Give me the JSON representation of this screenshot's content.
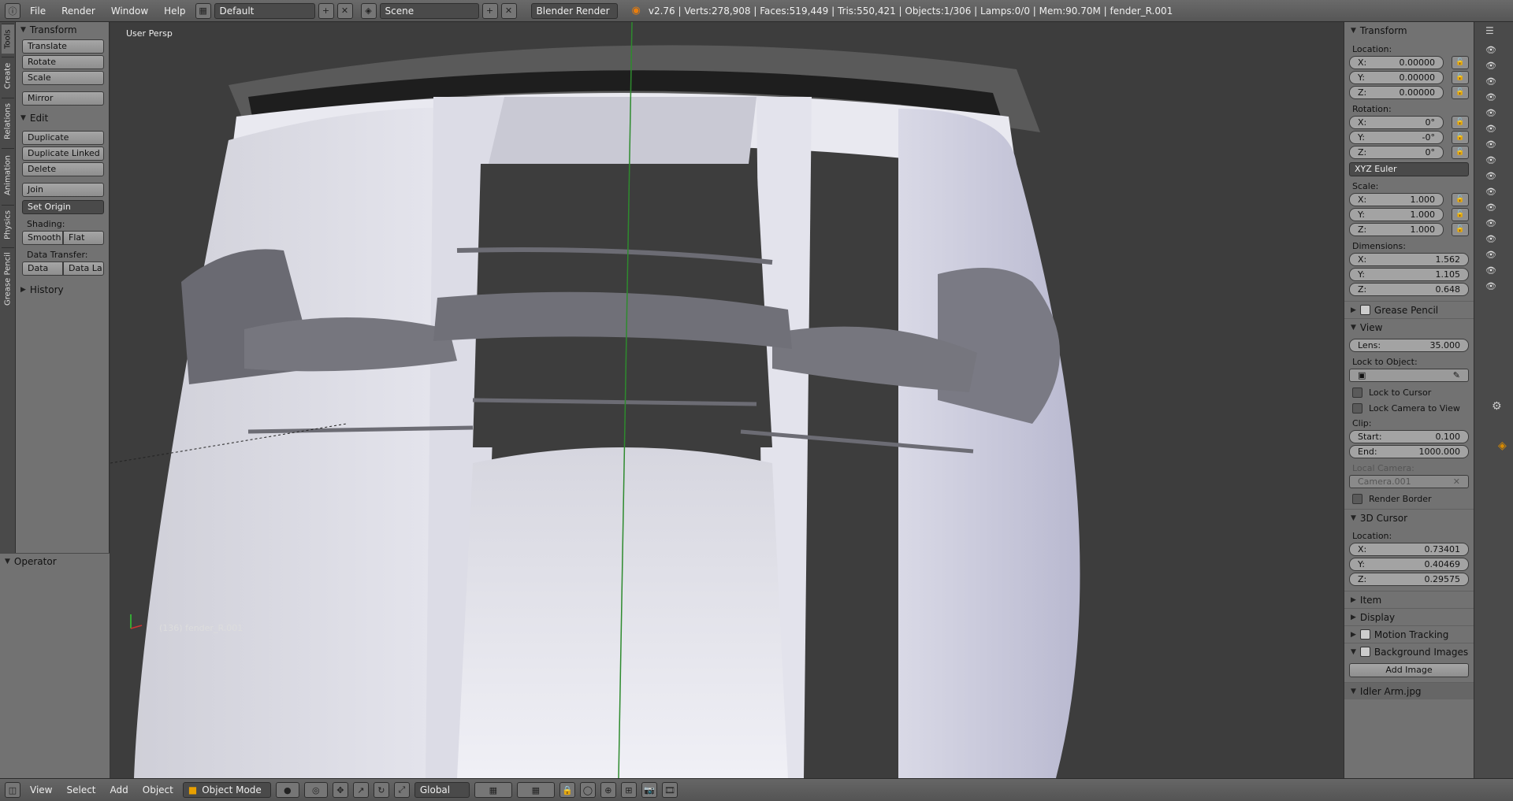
{
  "topbar": {
    "menus": [
      "File",
      "Render",
      "Window",
      "Help"
    ],
    "layout": "Default",
    "scene": "Scene",
    "engine": "Blender Render",
    "stats": "v2.76 | Verts:278,908 | Faces:519,449 | Tris:550,421 | Objects:1/306 | Lamps:0/0 | Mem:90.70M | fender_R.001"
  },
  "lefttabs": [
    "Tools",
    "Create",
    "Relations",
    "Animation",
    "Physics",
    "Grease Pencil"
  ],
  "tools": {
    "transform_header": "Transform",
    "translate": "Translate",
    "rotate": "Rotate",
    "scale": "Scale",
    "mirror": "Mirror",
    "edit_header": "Edit",
    "duplicate": "Duplicate",
    "duplicate_linked": "Duplicate Linked",
    "delete": "Delete",
    "join": "Join",
    "set_origin": "Set Origin",
    "shading_label": "Shading:",
    "smooth": "Smooth",
    "flat": "Flat",
    "data_transfer_label": "Data Transfer:",
    "data": "Data",
    "data_la": "Data La",
    "history_header": "History"
  },
  "operator": {
    "header": "Operator"
  },
  "viewport": {
    "view_label": "User Persp",
    "object_label": "(136) fender_R.001"
  },
  "properties": {
    "transform_header": "Transform",
    "location_label": "Location:",
    "location": [
      {
        "axis": "X:",
        "value": "0.00000"
      },
      {
        "axis": "Y:",
        "value": "0.00000"
      },
      {
        "axis": "Z:",
        "value": "0.00000"
      }
    ],
    "rotation_label": "Rotation:",
    "rotation": [
      {
        "axis": "X:",
        "value": "0°"
      },
      {
        "axis": "Y:",
        "value": "-0°"
      },
      {
        "axis": "Z:",
        "value": "0°"
      }
    ],
    "rotation_mode": "XYZ Euler",
    "scale_label": "Scale:",
    "scale": [
      {
        "axis": "X:",
        "value": "1.000"
      },
      {
        "axis": "Y:",
        "value": "1.000"
      },
      {
        "axis": "Z:",
        "value": "1.000"
      }
    ],
    "dimensions_label": "Dimensions:",
    "dimensions": [
      {
        "axis": "X:",
        "value": "1.562"
      },
      {
        "axis": "Y:",
        "value": "1.105"
      },
      {
        "axis": "Z:",
        "value": "0.648"
      }
    ],
    "grease_pencil_header": "Grease Pencil",
    "view_header": "View",
    "lens_label": "Lens:",
    "lens_value": "35.000",
    "lock_to_object_label": "Lock to Object:",
    "lock_to_cursor": "Lock to Cursor",
    "lock_camera_to_view": "Lock Camera to View",
    "clip_label": "Clip:",
    "clip_start_label": "Start:",
    "clip_start": "0.100",
    "clip_end_label": "End:",
    "clip_end": "1000.000",
    "local_camera_label": "Local Camera:",
    "local_camera": "Camera.001",
    "render_border": "Render Border",
    "cursor_header": "3D Cursor",
    "cursor_location_label": "Location:",
    "cursor": [
      {
        "axis": "X:",
        "value": "0.73401"
      },
      {
        "axis": "Y:",
        "value": "0.40469"
      },
      {
        "axis": "Z:",
        "value": "0.29575"
      }
    ],
    "item_header": "Item",
    "display_header": "Display",
    "motion_tracking_header": "Motion Tracking",
    "background_images_header": "Background Images",
    "add_image": "Add Image",
    "image_name": "Idler Arm.jpg"
  },
  "bottombar": {
    "menus": [
      "View",
      "Select",
      "Add",
      "Object"
    ],
    "mode": "Object Mode",
    "orientation": "Global"
  }
}
